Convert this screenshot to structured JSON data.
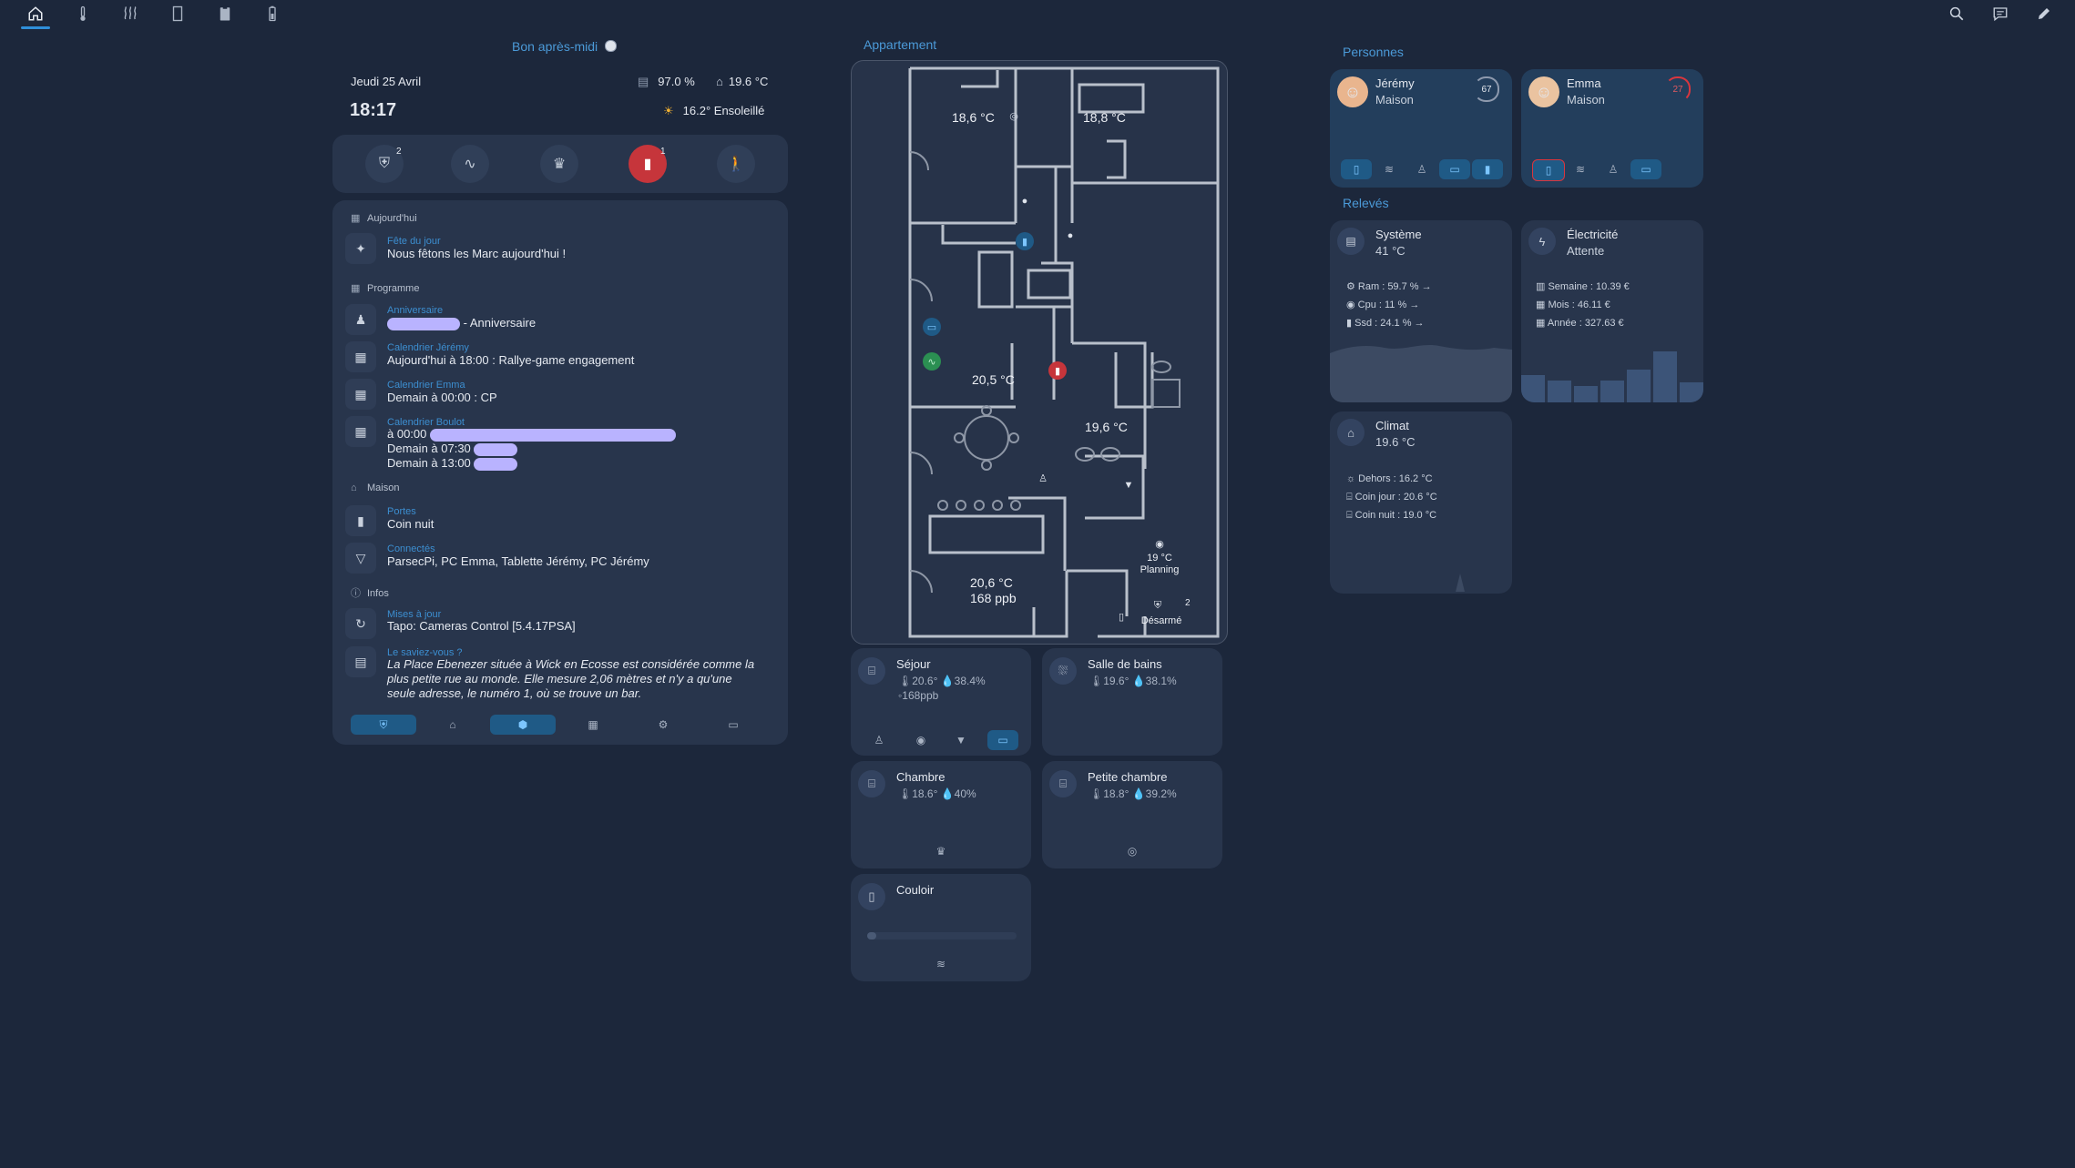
{
  "nav": {
    "tabs": [
      {
        "icon": "home-icon",
        "glyph": "⌂"
      },
      {
        "icon": "thermometer-icon",
        "glyph": "🌡"
      },
      {
        "icon": "heating-icon",
        "glyph": "♨"
      },
      {
        "icon": "door-icon",
        "glyph": "▯"
      },
      {
        "icon": "clipboard-icon",
        "glyph": "▣"
      },
      {
        "icon": "battery-icon",
        "glyph": "▮"
      }
    ],
    "right_icons": [
      "search-icon",
      "chat-icon",
      "edit-icon"
    ]
  },
  "left": {
    "greeting": "Bon après-midi",
    "date": "Jeudi 25 Avril",
    "time": "18:17",
    "humidity": "97.0 %",
    "indoor_temp": "19.6 °C",
    "weather": "16.2° Ensoleillé",
    "quick_buttons": [
      {
        "icon": "alarm-shield-icon",
        "badge": "2"
      },
      {
        "icon": "wave-icon",
        "badge": ""
      },
      {
        "icon": "lamp-icon",
        "badge": ""
      },
      {
        "icon": "door-open-icon",
        "badge": "1"
      },
      {
        "icon": "person-icon",
        "badge": ""
      }
    ],
    "today_header": "Aujourd'hui",
    "fete_label": "Fête du jour",
    "fete_text": "Nous fêtons les Marc aujourd'hui !",
    "programme_header": "Programme",
    "anniv_label": "Anniversaire",
    "anniv_text": "- Anniversaire",
    "cal_jeremy_label": "Calendrier Jérémy",
    "cal_jeremy_text": "Aujourd'hui à 18:00 : Rallye-game engagement",
    "cal_emma_label": "Calendrier Emma",
    "cal_emma_text": "Demain à 00:00 : CP",
    "cal_boulot_label": "Calendrier Boulot",
    "cal_boulot_1": "à 00:00",
    "cal_boulot_2": "Demain à 07:30",
    "cal_boulot_3": "Demain à 13:00",
    "maison_header": "Maison",
    "portes_label": "Portes",
    "portes_text": "Coin nuit",
    "connectes_label": "Connectés",
    "connectes_text": "ParsecPi, PC Emma, Tablette Jérémy, PC Jérémy",
    "infos_header": "Infos",
    "maj_label": "Mises à jour",
    "maj_text": "Tapo: Cameras Control [5.4.17PSA]",
    "savais_label": "Le saviez-vous ?",
    "savais_text": "La Place Ebenezer située à Wick en Ecosse est considérée comme la plus petite rue au monde. Elle mesure 2,06 mètres et n'y a qu'une seule adresse, le numéro 1, où se trouve un bar."
  },
  "center": {
    "title": "Appartement",
    "temps": {
      "t1": "18,6 °C",
      "t2": "18,8 °C",
      "t3": "20,5 °C",
      "t4": "19,6 °C",
      "t5": "20,6 °C",
      "t5b": "168 ppb"
    },
    "thermostat": "19 °C",
    "planning": "Planning",
    "alarm_badge": "2",
    "alarm_state": "Désarmé",
    "rooms": [
      {
        "name": "Séjour",
        "temp": "20.6°",
        "hum": "38.4%",
        "extra": "168ppb"
      },
      {
        "name": "Salle de bains",
        "temp": "19.6°",
        "hum": "38.1%"
      },
      {
        "name": "Chambre",
        "temp": "18.6°",
        "hum": "40%"
      },
      {
        "name": "Petite chambre",
        "temp": "18.8°",
        "hum": "39.2%"
      },
      {
        "name": "Couloir"
      }
    ]
  },
  "right": {
    "personnes_title": "Personnes",
    "persons": [
      {
        "name": "Jérémy",
        "state": "Maison",
        "battery": "67"
      },
      {
        "name": "Emma",
        "state": "Maison",
        "battery": "27"
      }
    ],
    "releves_title": "Relevés",
    "systeme": {
      "title": "Système",
      "value": "41 °C",
      "ram": "Ram : 59.7 % →",
      "cpu": "Cpu : 11 % →",
      "ssd": "Ssd : 24.1 % →"
    },
    "electricite": {
      "title": "Électricité",
      "value": "Attente",
      "semaine": "Semaine : 10.39 €",
      "mois": "Mois : 46.11 €",
      "annee": "Année : 327.63 €"
    },
    "climat": {
      "title": "Climat",
      "value": "19.6 °C",
      "dehors": "Dehors : 16.2 °C",
      "jour": "Coin jour : 20.6 °C",
      "nuit": "Coin nuit : 19.0 °C"
    }
  },
  "colors": {
    "accent": "#3aa0e6",
    "card": "#28354c",
    "bg": "#1c273b",
    "alert": "#d9363e"
  }
}
